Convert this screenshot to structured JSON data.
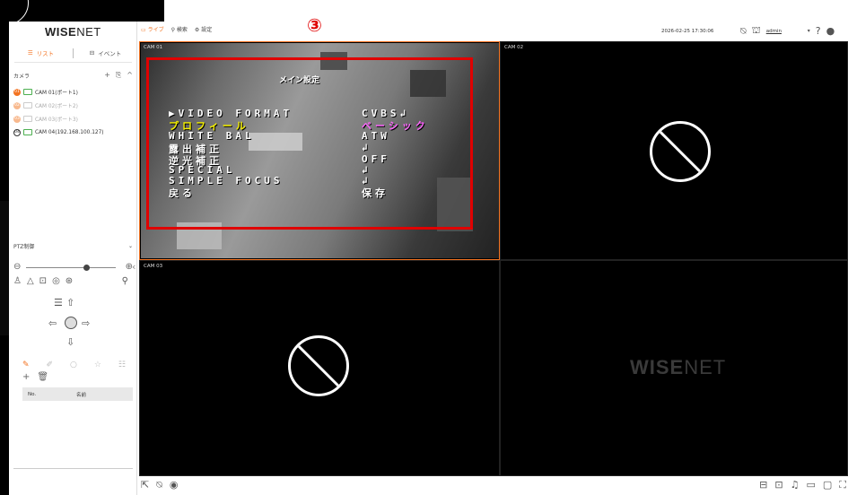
{
  "brand": {
    "logo_main": "WISE",
    "logo_suffix": "NET"
  },
  "sidebar": {
    "tabs": [
      {
        "label": "リスト",
        "icon": "list-icon"
      },
      {
        "label": "イベント",
        "icon": "event-icon"
      }
    ],
    "camera_header": "カメラ",
    "cameras": [
      {
        "badge": "01",
        "label": "CAM 01(ポート1)",
        "state": "active"
      },
      {
        "badge": "02",
        "label": "CAM 02(ポート2)",
        "state": "dim"
      },
      {
        "badge": "03",
        "label": "CAM 03(ポート3)",
        "state": "dim"
      },
      {
        "badge": "04",
        "label": "CAM 04(192.168.100.127)",
        "state": "outline"
      }
    ],
    "ptz_header": "PTZ制御",
    "preset_table": {
      "col_no": "No.",
      "col_name": "名前"
    }
  },
  "nav": {
    "live": "ライブ",
    "search": "検索",
    "settings": "設定"
  },
  "step_marker": "③",
  "datetime": "2026-02-25 17:30:06",
  "user": "admin",
  "tiles": [
    {
      "label": "CAM 01",
      "state": "video",
      "selected": true
    },
    {
      "label": "CAM 02",
      "state": "no-signal"
    },
    {
      "label": "CAM 03",
      "state": "no-signal"
    },
    {
      "label": "",
      "state": "empty"
    }
  ],
  "watermark": {
    "main": "WISE",
    "suffix": "NET"
  },
  "osd": {
    "title": "メイン設定",
    "rows": [
      {
        "label": "▶VIDEO FORMAT",
        "value": "CVBS↲",
        "label_color": "white",
        "value_color": "white"
      },
      {
        "label": "プロフィール",
        "value": "ベーシック",
        "label_color": "yellow",
        "value_color": "magenta"
      },
      {
        "label": "WHITE BAL",
        "value": "ATW",
        "label_color": "white",
        "value_color": "white"
      },
      {
        "label": "露出補正",
        "value": "↲",
        "label_color": "white",
        "value_color": "white"
      },
      {
        "label": "逆光補正",
        "value": "OFF",
        "label_color": "white",
        "value_color": "white"
      },
      {
        "label": "SPECIAL",
        "value": "↲",
        "label_color": "white",
        "value_color": "white"
      },
      {
        "label": "SIMPLE FOCUS",
        "value": "↲",
        "label_color": "white",
        "value_color": "white"
      },
      {
        "label": "戻る",
        "value": "保存",
        "label_color": "white",
        "value_color": "white"
      }
    ]
  },
  "colors": {
    "accent": "#f37321",
    "highlight": "#e00000",
    "online": "#4caf50"
  }
}
